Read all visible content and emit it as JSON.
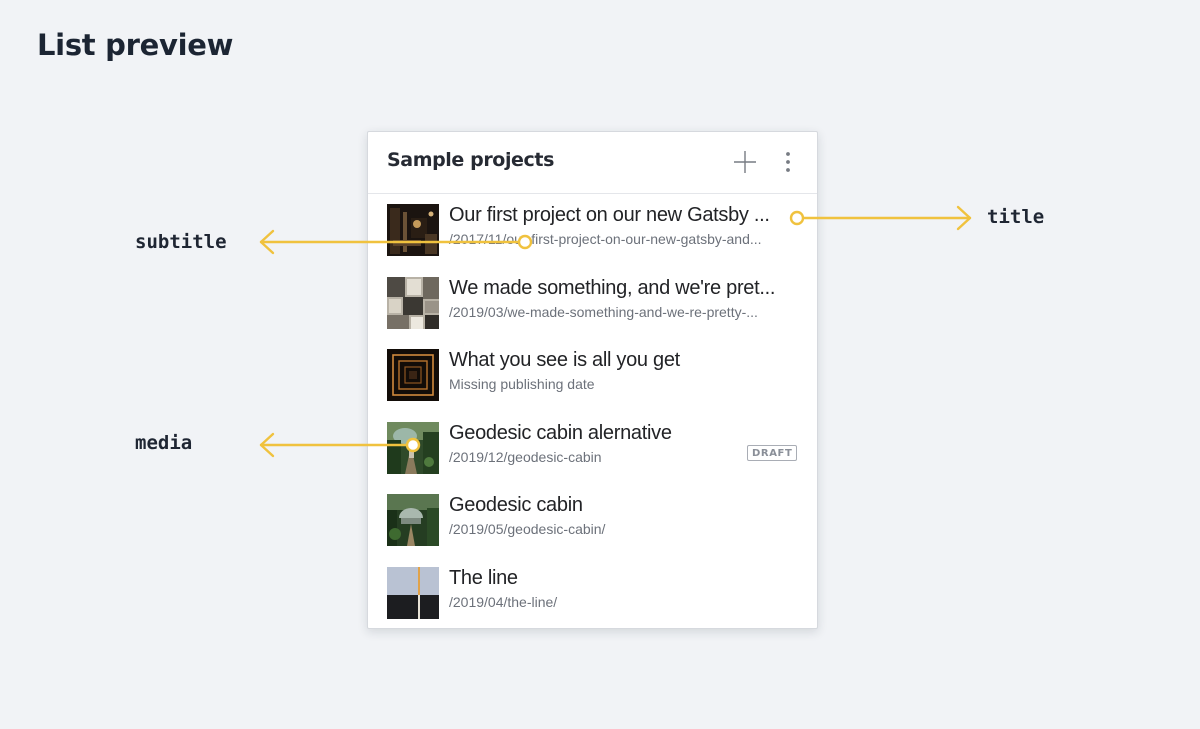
{
  "page": {
    "heading": "List preview"
  },
  "panel": {
    "title": "Sample projects",
    "actions": {
      "add_icon": "plus-icon",
      "menu_icon": "vertical-ellipsis-icon"
    },
    "items": [
      {
        "title": "Our first project on our new Gatsby ...",
        "subtitle": "/2017/11/our-first-project-on-our-new-gatsby-and...",
        "thumbnail": "dark-interior-photo",
        "badge": ""
      },
      {
        "title": "We made something, and we're pret...",
        "subtitle": "/2019/03/we-made-something-and-we-re-pretty-...",
        "thumbnail": "collage-photo",
        "badge": ""
      },
      {
        "title": "What you see is all you get",
        "subtitle": "Missing publishing date",
        "thumbnail": "light-tunnel-photo",
        "badge": ""
      },
      {
        "title": "Geodesic cabin alernative",
        "subtitle": "/2019/12/geodesic-cabin",
        "thumbnail": "forest-cabin-photo",
        "badge": "DRAFT"
      },
      {
        "title": "Geodesic cabin",
        "subtitle": "/2019/05/geodesic-cabin/",
        "thumbnail": "forest-dome-photo",
        "badge": ""
      },
      {
        "title": "The line",
        "subtitle": "/2019/04/the-line/",
        "thumbnail": "horizon-line-photo",
        "badge": ""
      }
    ]
  },
  "annotations": {
    "subtitle": "subtitle",
    "title": "title",
    "media": "media",
    "color": "#f0c23e"
  }
}
